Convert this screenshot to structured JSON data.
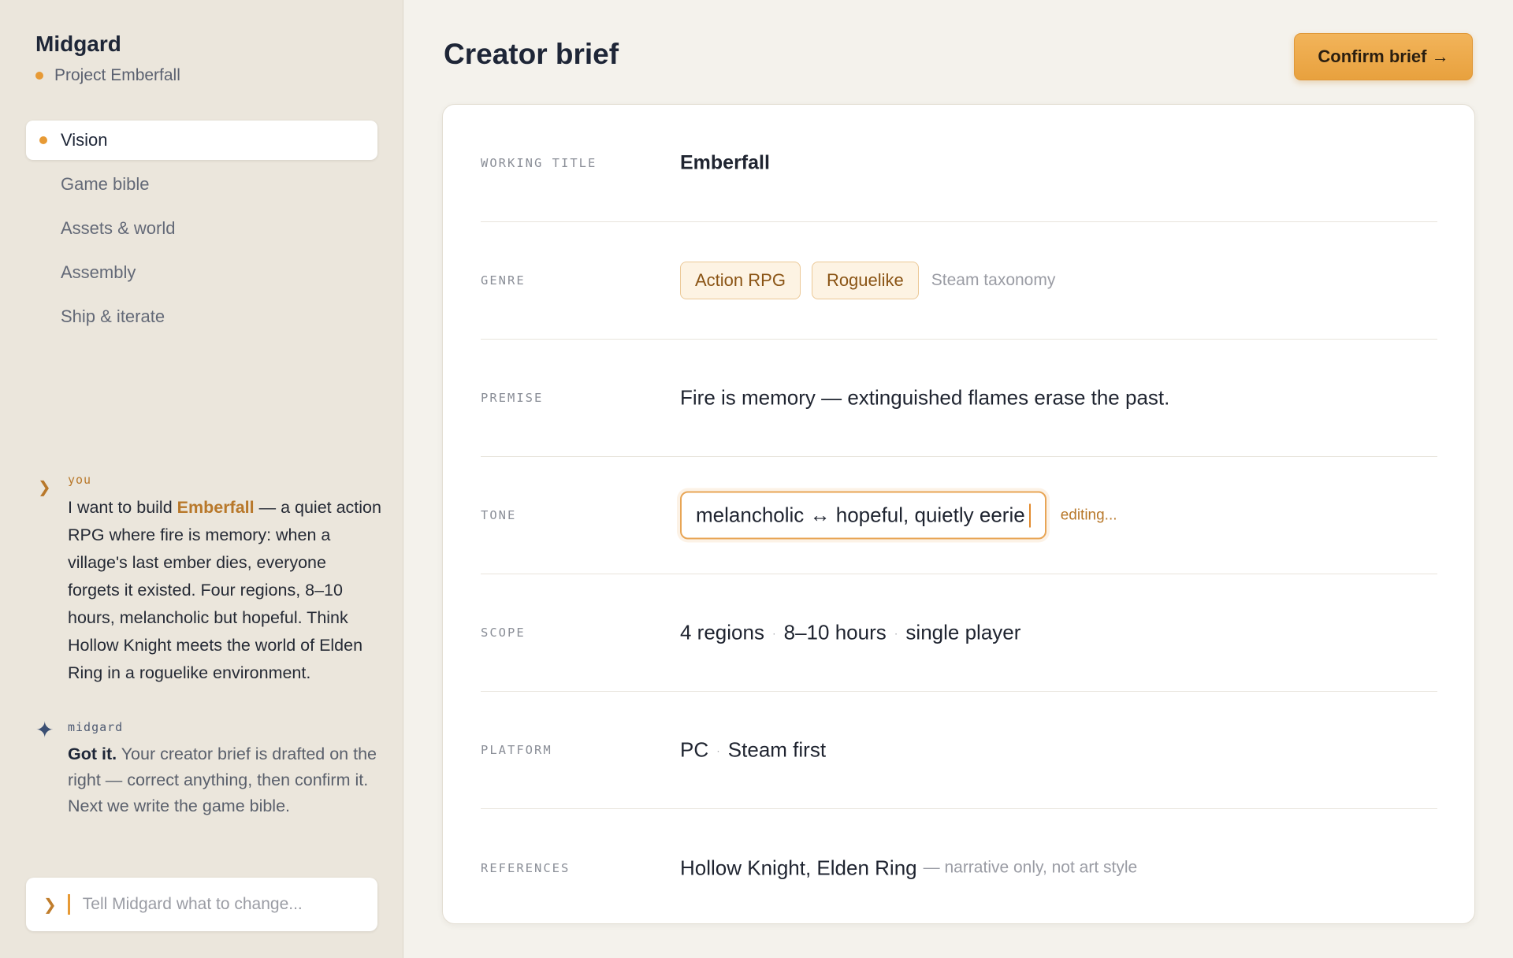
{
  "app": {
    "name": "Midgard",
    "project": "Project Emberfall",
    "accent": "#e79a35"
  },
  "nav": {
    "items": [
      {
        "label": "Vision",
        "active": true
      },
      {
        "label": "Game bible"
      },
      {
        "label": "Assets & world"
      },
      {
        "label": "Assembly"
      },
      {
        "label": "Ship & iterate"
      }
    ]
  },
  "chat": {
    "you": {
      "who": "you",
      "pre": "I want to build ",
      "highlight": "Emberfall",
      "post": " — a quiet action RPG where fire is memory: when a village's last ember dies, everyone forgets it existed. Four regions, 8–10 hours, melancholic but hopeful. Think Hollow Knight meets the world of Elden Ring in a roguelike environment."
    },
    "midgard": {
      "who": "midgard",
      "lead": "Got it.",
      "text": " Your creator brief is drafted on the right — correct anything, then confirm it. Next we write the game bible."
    },
    "input": {
      "placeholder": "Tell Midgard what to change..."
    }
  },
  "header": {
    "title": "Creator brief",
    "confirm_label": "Confirm brief →"
  },
  "brief": {
    "working_title": {
      "label": "WORKING TITLE",
      "value": "Emberfall"
    },
    "genre": {
      "label": "GENRE",
      "tags": [
        "Action RPG",
        "Roguelike"
      ],
      "note": "Steam taxonomy"
    },
    "premise": {
      "label": "PREMISE",
      "value": "Fire is memory — extinguished flames erase the past."
    },
    "tone": {
      "label": "TONE",
      "value": "melancholic ↔ hopeful, quietly eerie",
      "status": "editing..."
    },
    "scope": {
      "label": "SCOPE",
      "parts": [
        "4 regions",
        "8–10 hours",
        "single player"
      ],
      "separator": "·"
    },
    "platform": {
      "label": "PLATFORM",
      "parts": [
        "PC",
        "Steam first"
      ],
      "separator": "·"
    },
    "references": {
      "label": "REFERENCES",
      "value": "Hollow Knight, Elden Ring",
      "note": "— narrative only, not art style"
    }
  }
}
